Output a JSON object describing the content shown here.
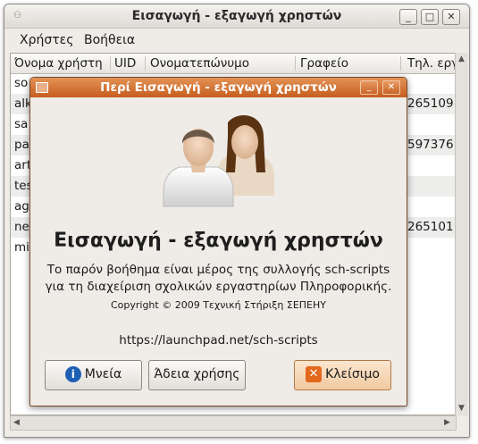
{
  "window": {
    "title": "Εισαγωγή - εξαγωγή χρηστών"
  },
  "menu": [
    "Χρήστες",
    "Βοήθεια"
  ],
  "table": {
    "columns": [
      "Όνομα χρήστη",
      "UID",
      "Ονοματεπώνυμο",
      "Γραφείο",
      "Τηλ. εργ"
    ],
    "rows": [
      {
        "user": "so",
        "tel": ""
      },
      {
        "user": "alk",
        "tel": "265109"
      },
      {
        "user": "sa",
        "tel": ""
      },
      {
        "user": "pa",
        "tel": "597376"
      },
      {
        "user": "art",
        "tel": ""
      },
      {
        "user": "tes",
        "tel": ""
      },
      {
        "user": "ag",
        "tel": ""
      },
      {
        "user": "ne",
        "tel": "265101"
      },
      {
        "user": "mi",
        "tel": ""
      }
    ]
  },
  "dialog": {
    "title": "Περί Εισαγωγή - εξαγωγή χρηστών",
    "heading": "Εισαγωγή - εξαγωγή χρηστών",
    "description_line1": "Το παρόν βοήθημα είναι μέρος της συλλογής sch-scripts",
    "description_line2": "για τη διαχείριση σχολικών εργαστηρίων Πληροφορικής.",
    "copyright": "Copyright © 2009 Τεχνική Στήριξη ΣΕΠΕΗΥ",
    "url": "https://launchpad.net/sch-scripts",
    "buttons": {
      "credits": "Μνεία",
      "license": "Άδεια χρήσης",
      "close": "Κλείσιμο"
    }
  },
  "icons": {
    "credits": "info-icon",
    "close": "close-icon",
    "users": "users-icon"
  }
}
